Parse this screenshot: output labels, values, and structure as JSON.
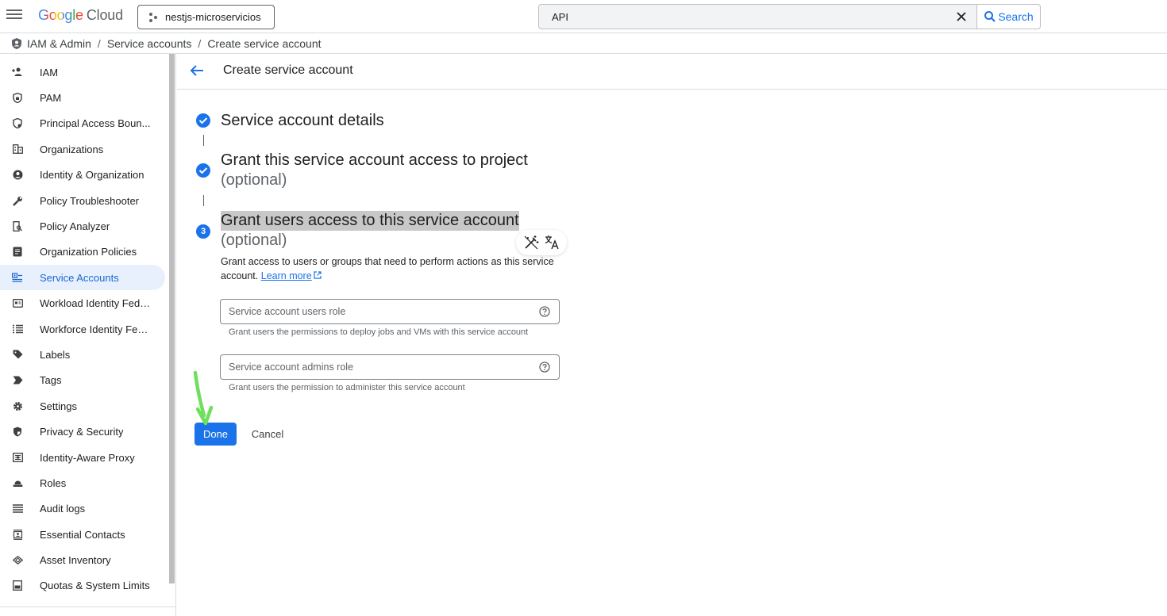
{
  "topbar": {
    "logo_google": "Google",
    "logo_cloud": "Cloud",
    "project_name": "nestjs-microservicios",
    "search_value": "API",
    "search_button": "Search"
  },
  "breadcrumb": {
    "items": [
      "IAM & Admin",
      "Service accounts",
      "Create service account"
    ],
    "separator": "/"
  },
  "sidebar": {
    "items": [
      {
        "label": "IAM",
        "icon": "person-add-icon"
      },
      {
        "label": "PAM",
        "icon": "shield-lock-icon"
      },
      {
        "label": "Principal Access Boun...",
        "icon": "policy-icon"
      },
      {
        "label": "Organizations",
        "icon": "building-icon"
      },
      {
        "label": "Identity & Organization",
        "icon": "account-circle-icon"
      },
      {
        "label": "Policy Troubleshooter",
        "icon": "wrench-icon"
      },
      {
        "label": "Policy Analyzer",
        "icon": "document-search-icon"
      },
      {
        "label": "Organization Policies",
        "icon": "list-alt-icon"
      },
      {
        "label": "Service Accounts",
        "icon": "service-account-icon",
        "active": true
      },
      {
        "label": "Workload Identity Fede...",
        "icon": "id-card-icon"
      },
      {
        "label": "Workforce Identity Fed...",
        "icon": "list-icon"
      },
      {
        "label": "Labels",
        "icon": "label-icon"
      },
      {
        "label": "Tags",
        "icon": "tag-arrow-icon"
      },
      {
        "label": "Settings",
        "icon": "gear-icon"
      },
      {
        "label": "Privacy & Security",
        "icon": "security-shield-icon"
      },
      {
        "label": "Identity-Aware Proxy",
        "icon": "proxy-icon"
      },
      {
        "label": "Roles",
        "icon": "roles-hat-icon"
      },
      {
        "label": "Audit logs",
        "icon": "lines-icon"
      },
      {
        "label": "Essential Contacts",
        "icon": "contacts-icon"
      },
      {
        "label": "Asset Inventory",
        "icon": "diamond-icon"
      },
      {
        "label": "Quotas & System Limits",
        "icon": "quota-icon"
      }
    ]
  },
  "page": {
    "title": "Create service account"
  },
  "steps": [
    {
      "title": "Service account details",
      "subtitle": "",
      "state": "done"
    },
    {
      "title": "Grant this service account access to project",
      "subtitle": "(optional)",
      "state": "done"
    },
    {
      "title": "Grant users access to this service account",
      "subtitle": "(optional)",
      "state": "current",
      "number": "3"
    }
  ],
  "step3": {
    "description": "Grant access to users or groups that need to perform actions as this service account.",
    "learn_more": "Learn more",
    "fields": [
      {
        "placeholder": "Service account users role",
        "hint": "Grant users the permissions to deploy jobs and VMs with this service account"
      },
      {
        "placeholder": "Service account admins role",
        "hint": "Grant users the permission to administer this service account"
      }
    ]
  },
  "actions": {
    "done": "Done",
    "cancel": "Cancel"
  },
  "colors": {
    "accent": "#1a73e8",
    "active_bg": "#e8f0fe",
    "arrow_annotation": "#6ee05c"
  }
}
